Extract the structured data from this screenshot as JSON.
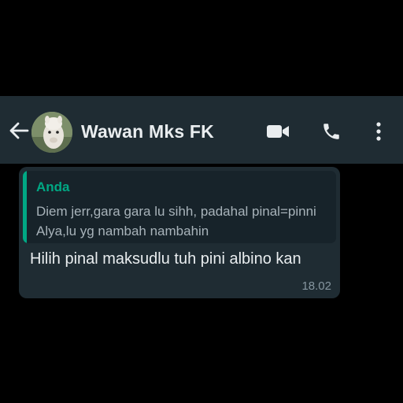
{
  "header": {
    "contact_name": "Wawan Mks FK",
    "icons": [
      "back-arrow-icon",
      "video-call-icon",
      "voice-call-icon",
      "more-options-icon"
    ],
    "colors": {
      "background": "#1f2c33",
      "text": "#e9edef"
    }
  },
  "message": {
    "quoted": {
      "author": "Anda",
      "text": "Diem jerr,gara gara lu sihh, padahal pinal=pinni Alya,lu yg nambah nambahin"
    },
    "text": "Hilih pinal maksudlu tuh pini albino kan",
    "time": "18.02",
    "colors": {
      "bubble": "#1f2c33",
      "quote_bar": "#00a884",
      "author": "#00a884"
    }
  }
}
